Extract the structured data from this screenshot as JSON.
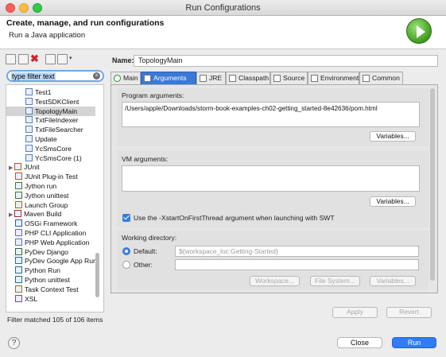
{
  "window": {
    "title": "Run Configurations"
  },
  "header": {
    "title": "Create, manage, and run configurations",
    "subtitle": "Run a Java application"
  },
  "filter": {
    "text": "type filter text"
  },
  "tree": {
    "items": [
      {
        "label": "Test1",
        "indent": 2,
        "selected": false
      },
      {
        "label": "TestSDKClient",
        "indent": 2,
        "selected": false
      },
      {
        "label": "TopologyMain",
        "indent": 2,
        "selected": true
      },
      {
        "label": "TxtFileIndexer",
        "indent": 2,
        "selected": false
      },
      {
        "label": "TxtFileSearcher",
        "indent": 2,
        "selected": false
      },
      {
        "label": "Update",
        "indent": 2,
        "selected": false
      },
      {
        "label": "YcSmsCore",
        "indent": 2,
        "selected": false
      },
      {
        "label": "YcSmsCore (1)",
        "indent": 2,
        "selected": false
      },
      {
        "label": "JUnit",
        "indent": 0,
        "selected": false,
        "expander": "▶"
      },
      {
        "label": "JUnit Plug-in Test",
        "indent": 1,
        "selected": false
      },
      {
        "label": "Jython run",
        "indent": 1,
        "selected": false
      },
      {
        "label": "Jython unittest",
        "indent": 1,
        "selected": false
      },
      {
        "label": "Launch Group",
        "indent": 1,
        "selected": false
      },
      {
        "label": "Maven Build",
        "indent": 0,
        "selected": false,
        "expander": "▶"
      },
      {
        "label": "OSGi Framework",
        "indent": 1,
        "selected": false
      },
      {
        "label": "PHP CLI Application",
        "indent": 1,
        "selected": false
      },
      {
        "label": "PHP Web Application",
        "indent": 1,
        "selected": false
      },
      {
        "label": "PyDev Django",
        "indent": 1,
        "selected": false
      },
      {
        "label": "PyDev Google App Run",
        "indent": 1,
        "selected": false
      },
      {
        "label": "Python Run",
        "indent": 1,
        "selected": false
      },
      {
        "label": "Python unittest",
        "indent": 1,
        "selected": false
      },
      {
        "label": "Task Context Test",
        "indent": 1,
        "selected": false
      },
      {
        "label": "XSL",
        "indent": 1,
        "selected": false
      }
    ]
  },
  "filter_status": "Filter matched 105 of 106 items",
  "name": {
    "label": "Name:",
    "value": "TopologyMain"
  },
  "tabs": [
    {
      "label": "Main",
      "active": false
    },
    {
      "label": "Arguments",
      "active": true
    },
    {
      "label": "JRE",
      "active": false
    },
    {
      "label": "Classpath",
      "active": false
    },
    {
      "label": "Source",
      "active": false
    },
    {
      "label": "Environment",
      "active": false
    },
    {
      "label": "Common",
      "active": false
    }
  ],
  "arguments": {
    "program_label": "Program arguments:",
    "program_value": "/Users/apple/Downloads/storm-book-examples-ch02-getting_started-8e42636/pom.html",
    "variables_label": "Variables...",
    "vm_label": "VM arguments:",
    "vm_value": "",
    "xstart_label": "Use the -XstartOnFirstThread argument when launching with SWT",
    "xstart_checked": true,
    "workdir_label": "Working directory:",
    "default_label": "Default:",
    "default_value": "${workspace_loc:Getting-Started}",
    "other_label": "Other:",
    "other_value": "",
    "workspace_btn": "Workspace...",
    "filesystem_btn": "File System...",
    "variables_btn": "Variables..."
  },
  "actions": {
    "apply": "Apply",
    "revert": "Revert",
    "close": "Close",
    "run": "Run",
    "help": "?"
  },
  "colors": {
    "accent": "#3a79d6",
    "run_logo": "#3f9c1e"
  }
}
